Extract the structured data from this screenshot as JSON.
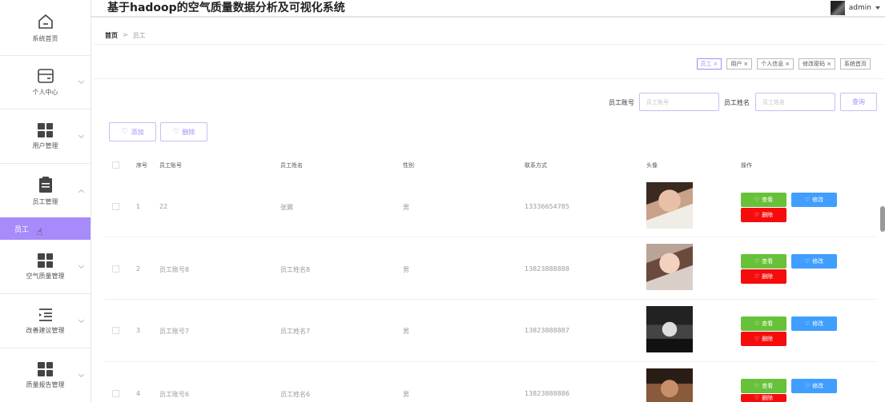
{
  "app": {
    "title": "基于hadoop的空气质量数据分析及可视化系统",
    "user": "admin"
  },
  "sidebar": {
    "items": [
      {
        "label": "系统首页",
        "icon": "home-icon"
      },
      {
        "label": "个人中心",
        "icon": "wallet-icon"
      },
      {
        "label": "用户管理",
        "icon": "grid-icon"
      },
      {
        "label": "员工管理",
        "icon": "clipboard-icon"
      },
      {
        "label": "员工",
        "icon": ""
      },
      {
        "label": "空气质量管理",
        "icon": "grid-icon"
      },
      {
        "label": "改善建议管理",
        "icon": "list-icon"
      },
      {
        "label": "质量报告管理",
        "icon": "grid-icon"
      }
    ]
  },
  "breadcrumb": {
    "home": "首页",
    "sep": ">",
    "current": "员工"
  },
  "tags": [
    {
      "label": "员工",
      "close": "×"
    },
    {
      "label": "用户",
      "close": "×"
    },
    {
      "label": "个人信息",
      "close": "×"
    },
    {
      "label": "修改密码",
      "close": "×"
    },
    {
      "label": "系统首页",
      "close": ""
    }
  ],
  "search": {
    "account_label": "员工账号",
    "account_placeholder": "员工账号",
    "name_label": "员工姓名",
    "name_placeholder": "员工姓名",
    "query_label": "查询"
  },
  "actions": {
    "add_label": "添加",
    "delete_label": "删除"
  },
  "table": {
    "headers": [
      "序号",
      "员工账号",
      "员工姓名",
      "性别",
      "联系方式",
      "头像",
      "操作"
    ],
    "rows": [
      {
        "index": "1",
        "account": "22",
        "name": "张翼",
        "gender": "男",
        "phone": "13336654785"
      },
      {
        "index": "2",
        "account": "员工账号8",
        "name": "员工姓名8",
        "gender": "男",
        "phone": "13823888888"
      },
      {
        "index": "3",
        "account": "员工账号7",
        "name": "员工姓名7",
        "gender": "男",
        "phone": "13823888887"
      },
      {
        "index": "4",
        "account": "员工账号6",
        "name": "员工姓名6",
        "gender": "男",
        "phone": "13823888886"
      }
    ],
    "ops": {
      "view": "查看",
      "edit": "修改",
      "delete": "删除"
    }
  },
  "colors": {
    "accent": "#a78bfa",
    "view": "#67c23a",
    "edit": "#409eff",
    "delete": "#f50c0c"
  }
}
